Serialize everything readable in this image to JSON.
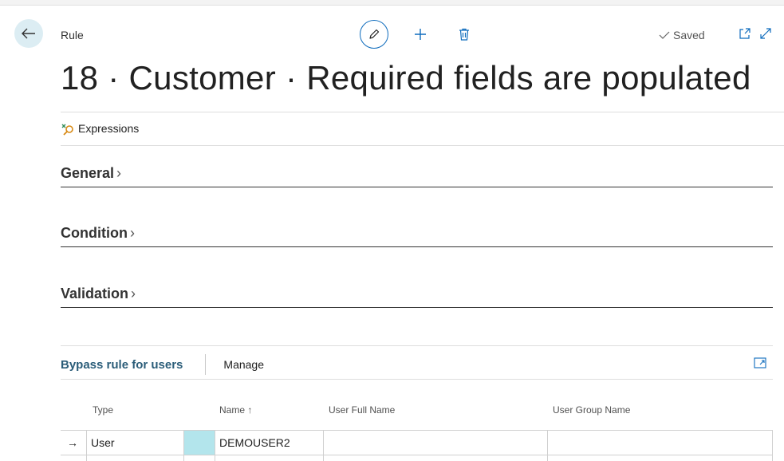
{
  "header": {
    "caption": "Rule",
    "title": "18 · Customer · Required fields are populated",
    "saved": "Saved"
  },
  "icons": {
    "back": "arrow-left-icon",
    "edit": "pencil-icon",
    "new": "plus-icon",
    "delete": "trash-icon",
    "saved": "checkmark-icon",
    "open_new_window": "open-in-new-window-icon",
    "expand": "expand-icon",
    "expressions": "expressions-icon",
    "subpage_expand": "subpage-expand-icon"
  },
  "actions": {
    "expressions": "Expressions"
  },
  "sections": {
    "general": "General",
    "condition": "Condition",
    "validation": "Validation",
    "chevron": "›"
  },
  "subpage": {
    "title": "Bypass rule for users",
    "manage": "Manage",
    "columns": {
      "type": "Type",
      "name": "Name",
      "name_sort": "↑",
      "full_name": "User Full Name",
      "group_name": "User Group Name"
    },
    "rows": [
      {
        "indicator": "→",
        "type": "User",
        "name": "DEMOUSER2",
        "full_name": "",
        "group_name": ""
      }
    ]
  },
  "colors": {
    "accent": "#0f6cbd",
    "subpage_title": "#2b5d79",
    "back_bg": "#dcedf3",
    "cell_highlight": "#b3e5ec"
  }
}
